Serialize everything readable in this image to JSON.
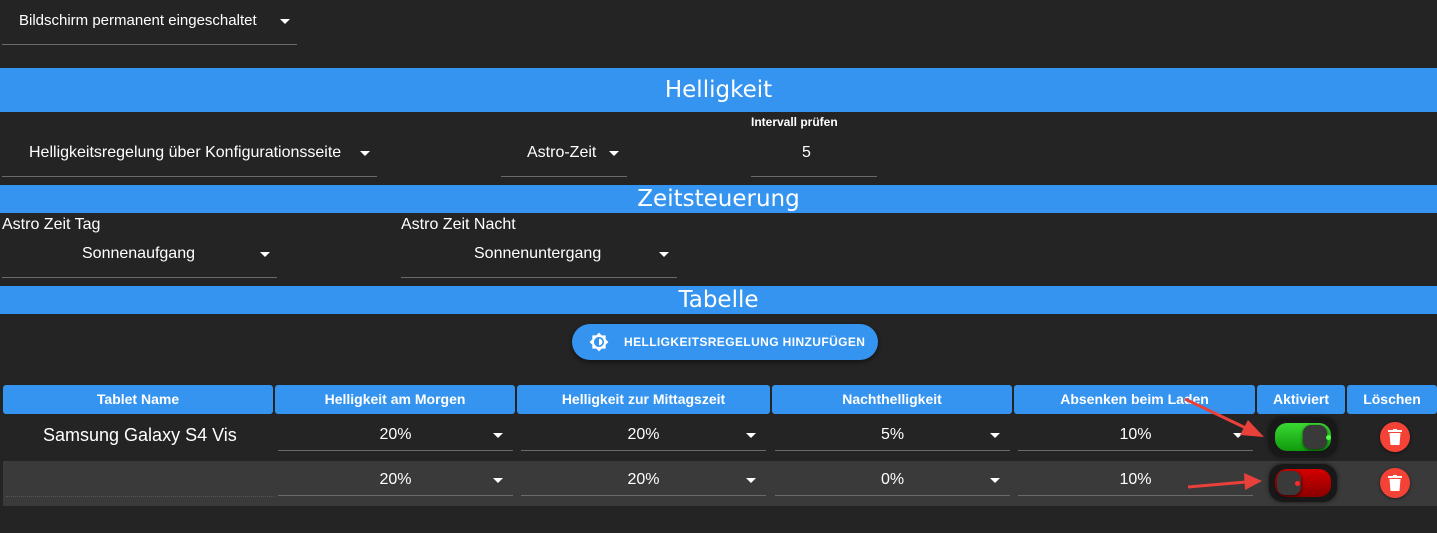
{
  "top_select": {
    "value": "Bildschirm permanent eingeschaltet"
  },
  "sections": {
    "helligkeit": "Helligkeit",
    "zeitsteuerung": "Zeitsteuerung",
    "tabelle": "Tabelle"
  },
  "brightness_config": {
    "mode_value": "Helligkeitsregelung über Konfigurationsseite",
    "time_value": "Astro-Zeit",
    "interval_label": "Intervall prüfen",
    "interval_value": "5"
  },
  "astro": {
    "day_label": "Astro Zeit Tag",
    "day_value": "Sonnenaufgang",
    "night_label": "Astro Zeit Nacht",
    "night_value": "Sonnenuntergang"
  },
  "add_button_label": "HELLIGKEITSREGELUNG HINZUFÜGEN",
  "table": {
    "headers": [
      "Tablet Name",
      "Helligkeit am Morgen",
      "Helligkeit zur Mittagszeit",
      "Nachthelligkeit",
      "Absenken beim Laden",
      "Aktiviert",
      "Löschen"
    ],
    "rows": [
      {
        "name": "Samsung Galaxy S4 Vis",
        "morning": "20%",
        "noon": "20%",
        "night": "5%",
        "charging": "10%",
        "active": true
      },
      {
        "name": "",
        "morning": "20%",
        "noon": "20%",
        "night": "0%",
        "charging": "10%",
        "active": false
      }
    ]
  },
  "icons": {
    "add_button": "brightness-icon",
    "delete": "trash-icon",
    "annotation": "red-arrow"
  },
  "colors": {
    "background": "#242424",
    "accent": "#3594f0",
    "toggle_on": "#22c51c",
    "toggle_off": "#c00000",
    "delete": "#f44336",
    "arrow": "#e8403a"
  }
}
